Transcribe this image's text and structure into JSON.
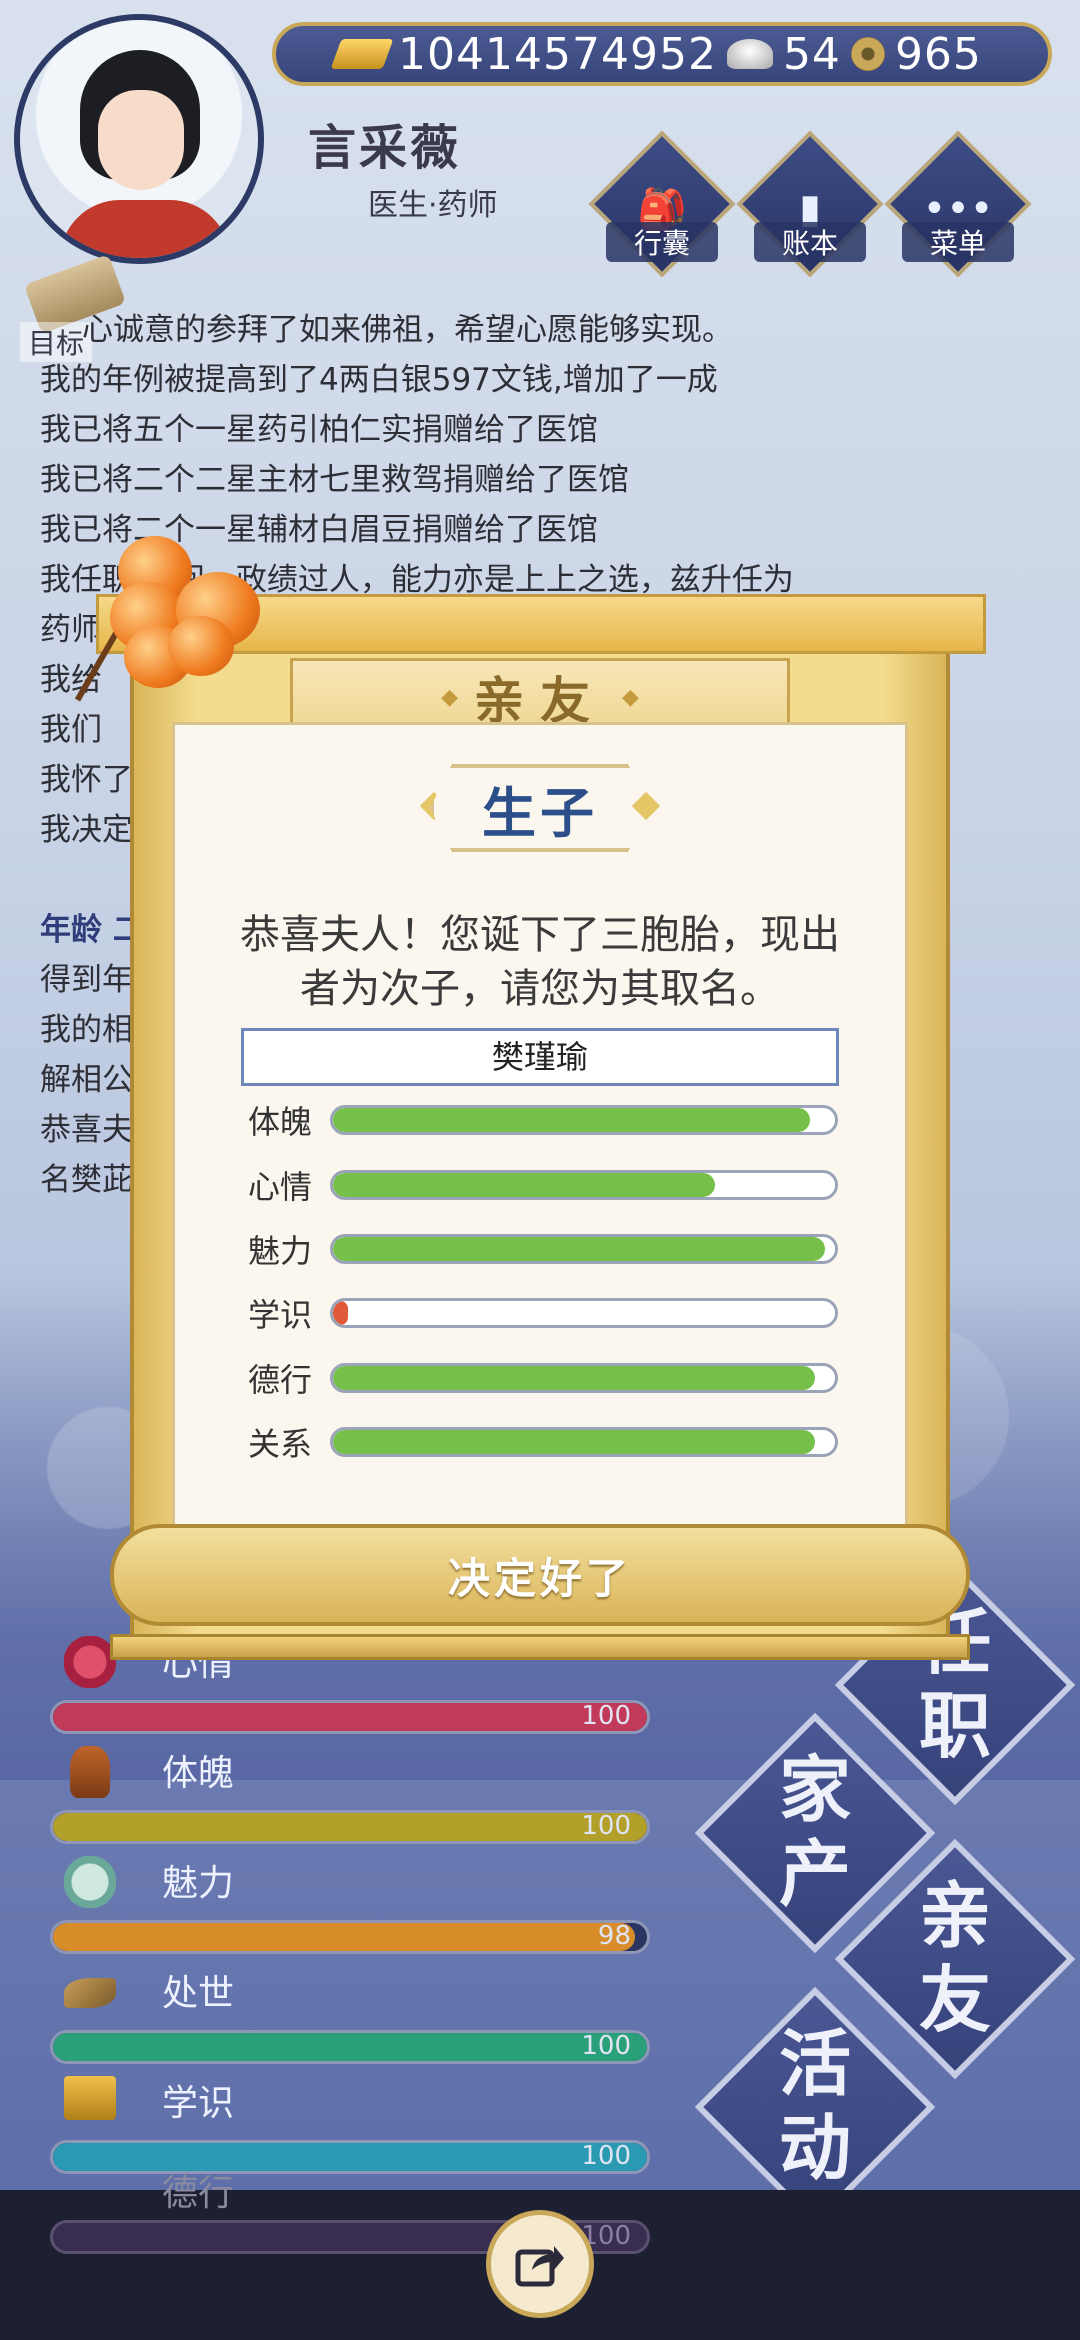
{
  "currency": {
    "gold": "10414574952",
    "silver": "54",
    "coins": "965"
  },
  "player": {
    "name": "言采薇",
    "title": "医生·药师"
  },
  "top_menu": [
    {
      "label": "行囊",
      "icon": "bag-icon"
    },
    {
      "label": "账本",
      "icon": "ledger-icon"
    },
    {
      "label": "菜单",
      "icon": "menu-dots-icon"
    }
  ],
  "goal_label": "目标",
  "log": {
    "lines": [
      "心诚意的参拜了如来佛祖，希望心愿能够实现。",
      "我的年例被提高到了4两白银597文钱,增加了一成",
      "我已将五个一星药引柏仁实捐赠给了医馆",
      "我已将二个二星主材七里救驾捐赠给了医馆",
      "我已将二个一星辅材白眉豆捐赠给了医馆",
      "我任职             期间，政绩过人，能力亦是上上之选，兹升任为",
      "药师",
      "我给",
      "我们",
      "我怀了",
      "我决定"
    ],
    "age_line": "年龄 二",
    "lines2": [
      "得到年",
      "我的相                                                          我劝",
      "解相公",
      "恭喜夫                                                          子取",
      "名樊茈"
    ]
  },
  "dialog": {
    "header": "亲友",
    "subtitle": "生子",
    "message_line1": "恭喜夫人！您诞下了三胞胎，现出",
    "message_line2": "者为次子，请您为其取名。",
    "name_value": "樊瑾瑜",
    "stats": [
      {
        "label": "体魄",
        "value": 0.95,
        "color": "#76c04a"
      },
      {
        "label": "心情",
        "value": 0.76,
        "color": "#76c04a"
      },
      {
        "label": "魅力",
        "value": 0.98,
        "color": "#76c04a"
      },
      {
        "label": "学识",
        "value": 0.03,
        "color": "#e05a3a"
      },
      {
        "label": "德行",
        "value": 0.96,
        "color": "#76c04a"
      },
      {
        "label": "关系",
        "value": 0.96,
        "color": "#76c04a"
      }
    ],
    "confirm_label": "决定好了"
  },
  "bottom_stats": [
    {
      "label": "心情",
      "value": "100",
      "fill": 1.0,
      "color": "#c23a5a",
      "icon": "flower-icon"
    },
    {
      "label": "体魄",
      "value": "100",
      "fill": 1.0,
      "color": "#b3a02a",
      "icon": "vase-icon"
    },
    {
      "label": "魅力",
      "value": "98",
      "fill": 0.98,
      "color": "#d98c2a",
      "icon": "mirror-icon"
    },
    {
      "label": "处世",
      "value": "100",
      "fill": 1.0,
      "color": "#2aa07a",
      "icon": "shoe-icon"
    },
    {
      "label": "学识",
      "value": "100",
      "fill": 1.0,
      "color": "#2a9ab3",
      "icon": "books-icon"
    },
    {
      "label": "德行",
      "value": "100",
      "fill": 1.0,
      "color": "#7a2a9a",
      "icon": "virtue-icon"
    }
  ],
  "tiles": [
    {
      "label": "任职"
    },
    {
      "label": "家产"
    },
    {
      "label": "亲友"
    },
    {
      "label": "活动"
    }
  ]
}
